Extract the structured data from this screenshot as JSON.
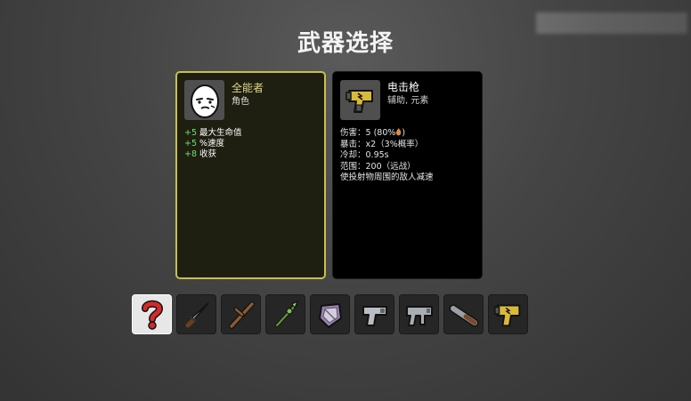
{
  "title": "武器选择",
  "character": {
    "name": "全能者",
    "type": "角色",
    "icon": "egg-face-icon",
    "stats": [
      {
        "value": "+5",
        "label": "最大生命值"
      },
      {
        "value": "+5",
        "label": "%速度"
      },
      {
        "value": "+8",
        "label": "收获"
      }
    ]
  },
  "weapon": {
    "name": "电击枪",
    "tags": "辅助, 元素",
    "icon": "taser-icon",
    "damage": "伤害：5 (80%",
    "damage_close": ")",
    "damage_icon": "elemental-flame-icon",
    "crit": "暴击：x2（3%概率）",
    "cooldown": "冷却：0.95s",
    "range": "范围：200（远战）",
    "effect": "使投射物周围的敌人减速"
  },
  "slots": [
    {
      "icon": "question-mark-icon",
      "selected": true
    },
    {
      "icon": "knife-icon"
    },
    {
      "icon": "stick-icon"
    },
    {
      "icon": "spear-icon"
    },
    {
      "icon": "shield-icon"
    },
    {
      "icon": "pistol-icon"
    },
    {
      "icon": "smg-icon"
    },
    {
      "icon": "shotgun-icon"
    },
    {
      "icon": "taser-icon"
    }
  ],
  "colors": {
    "accent_border": "#c8c04a",
    "char_name": "#e2d88a",
    "stat_positive": "#6ee36e",
    "slot_selected": "#e7e7e7"
  }
}
